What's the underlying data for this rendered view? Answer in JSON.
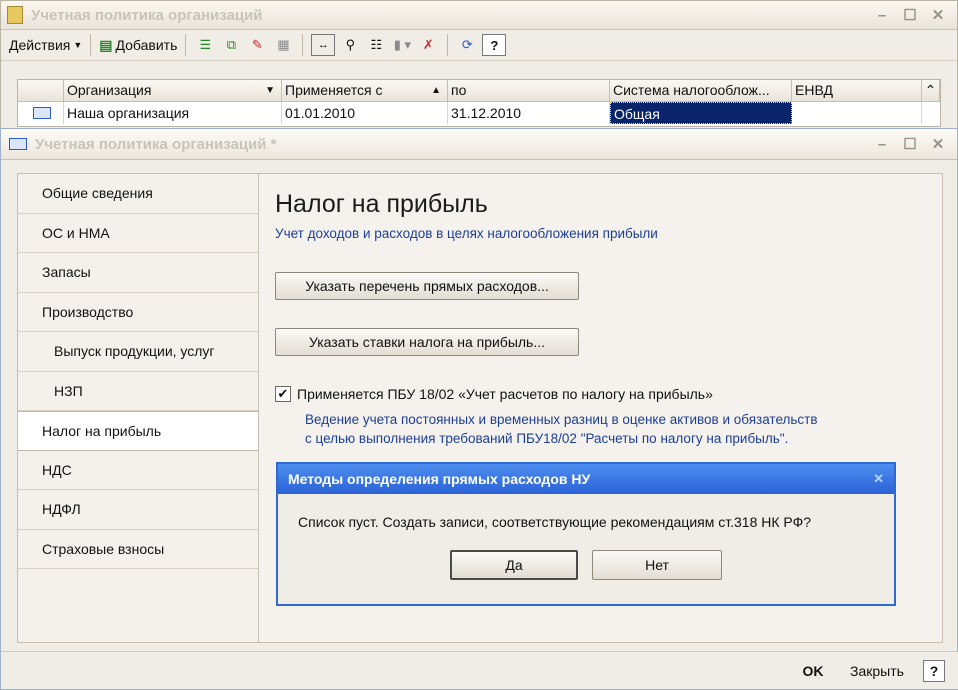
{
  "back_window": {
    "title": "Учетная политика организаций",
    "toolbar": {
      "actions_label": "Действия",
      "add_label": "Добавить"
    },
    "table": {
      "columns": [
        "Организация",
        "Применяется с",
        "по",
        "Система налогооблож...",
        "ЕНВД"
      ],
      "rows": [
        {
          "org": "Наша организация",
          "from": "01.01.2010",
          "to": "31.12.2010",
          "system": "Общая",
          "envd": ""
        }
      ]
    }
  },
  "front_window": {
    "title": "Учетная политика организаций *",
    "nav": [
      {
        "label": "Общие сведения"
      },
      {
        "label": "ОС и НМА"
      },
      {
        "label": "Запасы"
      },
      {
        "label": "Производство"
      },
      {
        "label": "Выпуск продукции, услуг"
      },
      {
        "label": "НЗП"
      },
      {
        "label": "Налог на прибыль",
        "active": true
      },
      {
        "label": "НДС"
      },
      {
        "label": "НДФЛ"
      },
      {
        "label": "Страховые взносы"
      }
    ],
    "content": {
      "title": "Налог на прибыль",
      "subtitle": "Учет доходов и расходов в целях налогообложения прибыли",
      "button_direct_costs": "Указать перечень прямых расходов...",
      "button_tax_rates": "Указать ставки налога на прибыль...",
      "checkbox_label": "Применяется ПБУ 18/02 «Учет расчетов по налогу на прибыль»",
      "checkbox_checked": true,
      "note_line1": "Ведение учета постоянных и временных разниц в оценке активов и обязательств",
      "note_line2": "с целью выполнения требований ПБУ18/02 \"Расчеты по налогу на прибыль\"."
    },
    "footer": {
      "ok_label": "OK",
      "close_label": "Закрыть",
      "help_label": "?"
    }
  },
  "dialog": {
    "title": "Методы определения прямых расходов НУ",
    "message": "Список пуст. Создать записи, соответствующие рекомендациям ст.318 НК РФ?",
    "yes_label": "Да",
    "no_label": "Нет"
  },
  "colors": {
    "selection": "#0a246a",
    "dialog_title": "#2a62d6",
    "link_text": "#1c3f94"
  }
}
